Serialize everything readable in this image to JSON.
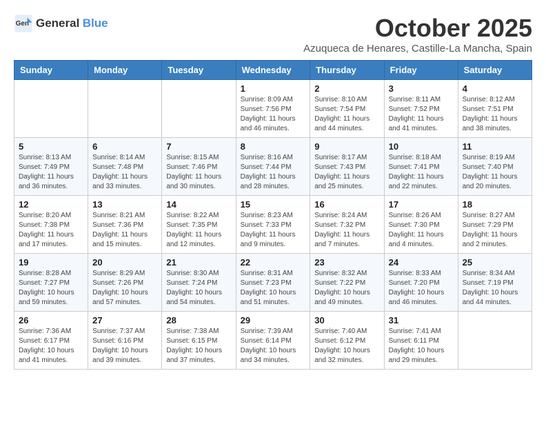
{
  "header": {
    "logo_general": "General",
    "logo_blue": "Blue",
    "month_title": "October 2025",
    "location": "Azuqueca de Henares, Castille-La Mancha, Spain"
  },
  "days_of_week": [
    "Sunday",
    "Monday",
    "Tuesday",
    "Wednesday",
    "Thursday",
    "Friday",
    "Saturday"
  ],
  "weeks": [
    [
      {
        "day": "",
        "info": ""
      },
      {
        "day": "",
        "info": ""
      },
      {
        "day": "",
        "info": ""
      },
      {
        "day": "1",
        "info": "Sunrise: 8:09 AM\nSunset: 7:56 PM\nDaylight: 11 hours and 46 minutes."
      },
      {
        "day": "2",
        "info": "Sunrise: 8:10 AM\nSunset: 7:54 PM\nDaylight: 11 hours and 44 minutes."
      },
      {
        "day": "3",
        "info": "Sunrise: 8:11 AM\nSunset: 7:52 PM\nDaylight: 11 hours and 41 minutes."
      },
      {
        "day": "4",
        "info": "Sunrise: 8:12 AM\nSunset: 7:51 PM\nDaylight: 11 hours and 38 minutes."
      }
    ],
    [
      {
        "day": "5",
        "info": "Sunrise: 8:13 AM\nSunset: 7:49 PM\nDaylight: 11 hours and 36 minutes."
      },
      {
        "day": "6",
        "info": "Sunrise: 8:14 AM\nSunset: 7:48 PM\nDaylight: 11 hours and 33 minutes."
      },
      {
        "day": "7",
        "info": "Sunrise: 8:15 AM\nSunset: 7:46 PM\nDaylight: 11 hours and 30 minutes."
      },
      {
        "day": "8",
        "info": "Sunrise: 8:16 AM\nSunset: 7:44 PM\nDaylight: 11 hours and 28 minutes."
      },
      {
        "day": "9",
        "info": "Sunrise: 8:17 AM\nSunset: 7:43 PM\nDaylight: 11 hours and 25 minutes."
      },
      {
        "day": "10",
        "info": "Sunrise: 8:18 AM\nSunset: 7:41 PM\nDaylight: 11 hours and 22 minutes."
      },
      {
        "day": "11",
        "info": "Sunrise: 8:19 AM\nSunset: 7:40 PM\nDaylight: 11 hours and 20 minutes."
      }
    ],
    [
      {
        "day": "12",
        "info": "Sunrise: 8:20 AM\nSunset: 7:38 PM\nDaylight: 11 hours and 17 minutes."
      },
      {
        "day": "13",
        "info": "Sunrise: 8:21 AM\nSunset: 7:36 PM\nDaylight: 11 hours and 15 minutes."
      },
      {
        "day": "14",
        "info": "Sunrise: 8:22 AM\nSunset: 7:35 PM\nDaylight: 11 hours and 12 minutes."
      },
      {
        "day": "15",
        "info": "Sunrise: 8:23 AM\nSunset: 7:33 PM\nDaylight: 11 hours and 9 minutes."
      },
      {
        "day": "16",
        "info": "Sunrise: 8:24 AM\nSunset: 7:32 PM\nDaylight: 11 hours and 7 minutes."
      },
      {
        "day": "17",
        "info": "Sunrise: 8:26 AM\nSunset: 7:30 PM\nDaylight: 11 hours and 4 minutes."
      },
      {
        "day": "18",
        "info": "Sunrise: 8:27 AM\nSunset: 7:29 PM\nDaylight: 11 hours and 2 minutes."
      }
    ],
    [
      {
        "day": "19",
        "info": "Sunrise: 8:28 AM\nSunset: 7:27 PM\nDaylight: 10 hours and 59 minutes."
      },
      {
        "day": "20",
        "info": "Sunrise: 8:29 AM\nSunset: 7:26 PM\nDaylight: 10 hours and 57 minutes."
      },
      {
        "day": "21",
        "info": "Sunrise: 8:30 AM\nSunset: 7:24 PM\nDaylight: 10 hours and 54 minutes."
      },
      {
        "day": "22",
        "info": "Sunrise: 8:31 AM\nSunset: 7:23 PM\nDaylight: 10 hours and 51 minutes."
      },
      {
        "day": "23",
        "info": "Sunrise: 8:32 AM\nSunset: 7:22 PM\nDaylight: 10 hours and 49 minutes."
      },
      {
        "day": "24",
        "info": "Sunrise: 8:33 AM\nSunset: 7:20 PM\nDaylight: 10 hours and 46 minutes."
      },
      {
        "day": "25",
        "info": "Sunrise: 8:34 AM\nSunset: 7:19 PM\nDaylight: 10 hours and 44 minutes."
      }
    ],
    [
      {
        "day": "26",
        "info": "Sunrise: 7:36 AM\nSunset: 6:17 PM\nDaylight: 10 hours and 41 minutes."
      },
      {
        "day": "27",
        "info": "Sunrise: 7:37 AM\nSunset: 6:16 PM\nDaylight: 10 hours and 39 minutes."
      },
      {
        "day": "28",
        "info": "Sunrise: 7:38 AM\nSunset: 6:15 PM\nDaylight: 10 hours and 37 minutes."
      },
      {
        "day": "29",
        "info": "Sunrise: 7:39 AM\nSunset: 6:14 PM\nDaylight: 10 hours and 34 minutes."
      },
      {
        "day": "30",
        "info": "Sunrise: 7:40 AM\nSunset: 6:12 PM\nDaylight: 10 hours and 32 minutes."
      },
      {
        "day": "31",
        "info": "Sunrise: 7:41 AM\nSunset: 6:11 PM\nDaylight: 10 hours and 29 minutes."
      },
      {
        "day": "",
        "info": ""
      }
    ]
  ]
}
